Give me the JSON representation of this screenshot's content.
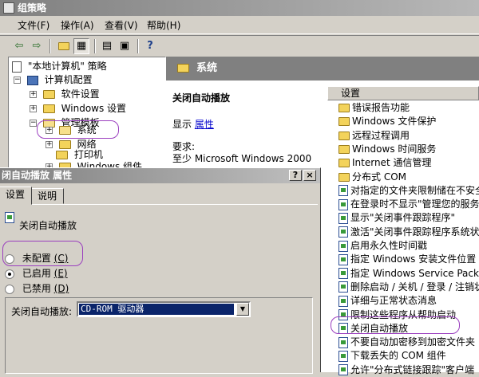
{
  "window": {
    "title": "组策略"
  },
  "menu": [
    "文件(F)",
    "操作(A)",
    "查看(V)",
    "帮助(H)"
  ],
  "toolbar": {
    "icons": [
      "back-arrow-icon",
      "forward-arrow-icon",
      "up-folder-icon",
      "show-hide-tree-icon",
      "properties-icon",
      "export-list-icon",
      "help-icon"
    ]
  },
  "tree": {
    "root": "\"本地计算机\" 策略",
    "computer_config": "计算机配置",
    "software_settings": "软件设置",
    "windows_settings": "Windows 设置",
    "admin_templates": "管理模板",
    "system": "系统",
    "network": "网络",
    "printer": "打印机",
    "partial": "Windows 组件"
  },
  "right_pane": {
    "header": "系统",
    "desc_title": "关闭自动播放",
    "show_label": "显示",
    "show_link": "属性",
    "req_label": "要求:",
    "req_value": "至少 Microsoft Windows 2000"
  },
  "list": {
    "column_header": "设置",
    "items": [
      {
        "label": "错误报告功能",
        "kind": "folder"
      },
      {
        "label": "Windows 文件保护",
        "kind": "folder"
      },
      {
        "label": "远程过程调用",
        "kind": "folder"
      },
      {
        "label": "Windows 时间服务",
        "kind": "folder"
      },
      {
        "label": "Internet 通信管理",
        "kind": "folder"
      },
      {
        "label": "分布式 COM",
        "kind": "folder"
      },
      {
        "label": "对指定的文件夹限制储在不安全",
        "kind": "policy"
      },
      {
        "label": "在登录时不显示\"管理您的服务",
        "kind": "policy"
      },
      {
        "label": "显示\"关闭事件跟踪程序\"",
        "kind": "policy"
      },
      {
        "label": "激活\"关闭事件跟踪程序系统状",
        "kind": "policy"
      },
      {
        "label": "启用永久性时间戳",
        "kind": "policy"
      },
      {
        "label": "指定 Windows 安装文件位置",
        "kind": "policy"
      },
      {
        "label": "指定 Windows Service Pack 安装",
        "kind": "policy"
      },
      {
        "label": "删除启动 / 关机 / 登录 / 注销状",
        "kind": "policy"
      },
      {
        "label": "详细与正常状态消息",
        "kind": "policy"
      },
      {
        "label": "限制这些程序从帮助启动",
        "kind": "policy"
      },
      {
        "label": "关闭自动播放",
        "kind": "policy"
      },
      {
        "label": "不要自动加密移到加密文件夹",
        "kind": "policy"
      },
      {
        "label": "下载丢失的 COM 组件",
        "kind": "policy"
      },
      {
        "label": "允许\"分布式链接跟踪\"客户端",
        "kind": "policy"
      }
    ]
  },
  "dialog": {
    "title": "闭自动播放 属性",
    "help_btn": "?",
    "close_btn": "×",
    "tabs": [
      "设置",
      "说明"
    ],
    "policy_name": "关闭自动播放",
    "radio_not_configured": "未配置",
    "radio_not_configured_key": "(C)",
    "radio_enabled": "已启用",
    "radio_enabled_key": "(E)",
    "radio_disabled": "已禁用",
    "radio_disabled_key": "(D)",
    "selected_option": "enabled",
    "combo_label": "关闭自动播放:",
    "combo_value": "CD-ROM 驱动器"
  }
}
